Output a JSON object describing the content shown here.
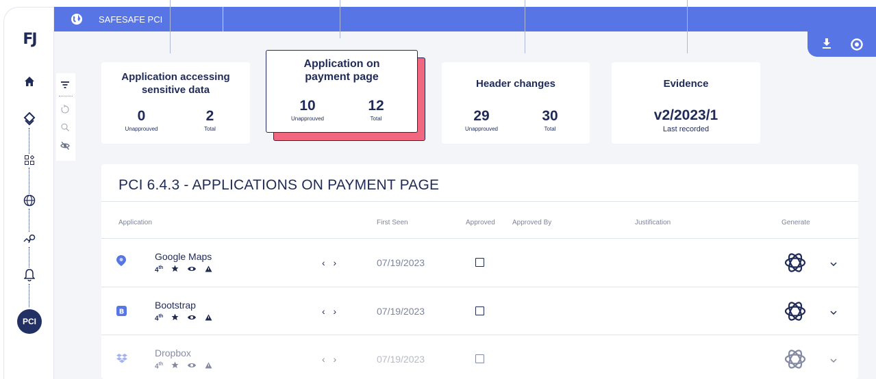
{
  "topbar": {
    "app_name": "SAFESAFE PCI"
  },
  "sidebar": {
    "logo": "FJ",
    "active_badge": "PCI"
  },
  "cards": [
    {
      "title": "Application accessing sensitive data",
      "unapproved": "0",
      "unapproved_label": "Unapprouved",
      "total": "2",
      "total_label": "Total"
    },
    {
      "title": "Application on payment page",
      "unapproved": "10",
      "unapproved_label": "Unapprouved",
      "total": "12",
      "total_label": "Total"
    },
    {
      "title": "Header changes",
      "unapproved": "29",
      "unapproved_label": "Unapprouved",
      "total": "30",
      "total_label": "Total"
    },
    {
      "title": "Evidence",
      "value": "v2/2023/1",
      "value_label": "Last recorded"
    }
  ],
  "panel": {
    "title": "PCI 6.4.3 - APPLICATIONS ON PAYMENT PAGE",
    "columns": {
      "application": "Application",
      "first_seen": "First Seen",
      "approved": "Approved",
      "approved_by": "Approved By",
      "justification": "Justification",
      "generate": "Generate"
    },
    "rows": [
      {
        "name": "Google Maps",
        "party": "4",
        "party_suffix": "th",
        "code": "‹ ›",
        "first_seen": "07/19/2023",
        "icon": "map-pin-icon"
      },
      {
        "name": "Bootstrap",
        "party": "4",
        "party_suffix": "th",
        "code": "‹ ›",
        "first_seen": "07/19/2023",
        "icon": "bootstrap-icon"
      },
      {
        "name": "Dropbox",
        "party": "4",
        "party_suffix": "th",
        "code": "‹ ›",
        "first_seen": "07/19/2023",
        "icon": "dropbox-icon"
      }
    ]
  },
  "colors": {
    "accent": "#5775e4",
    "navy": "#1f2a57",
    "highlight": "#f0677f",
    "background": "#f4f5f8"
  }
}
